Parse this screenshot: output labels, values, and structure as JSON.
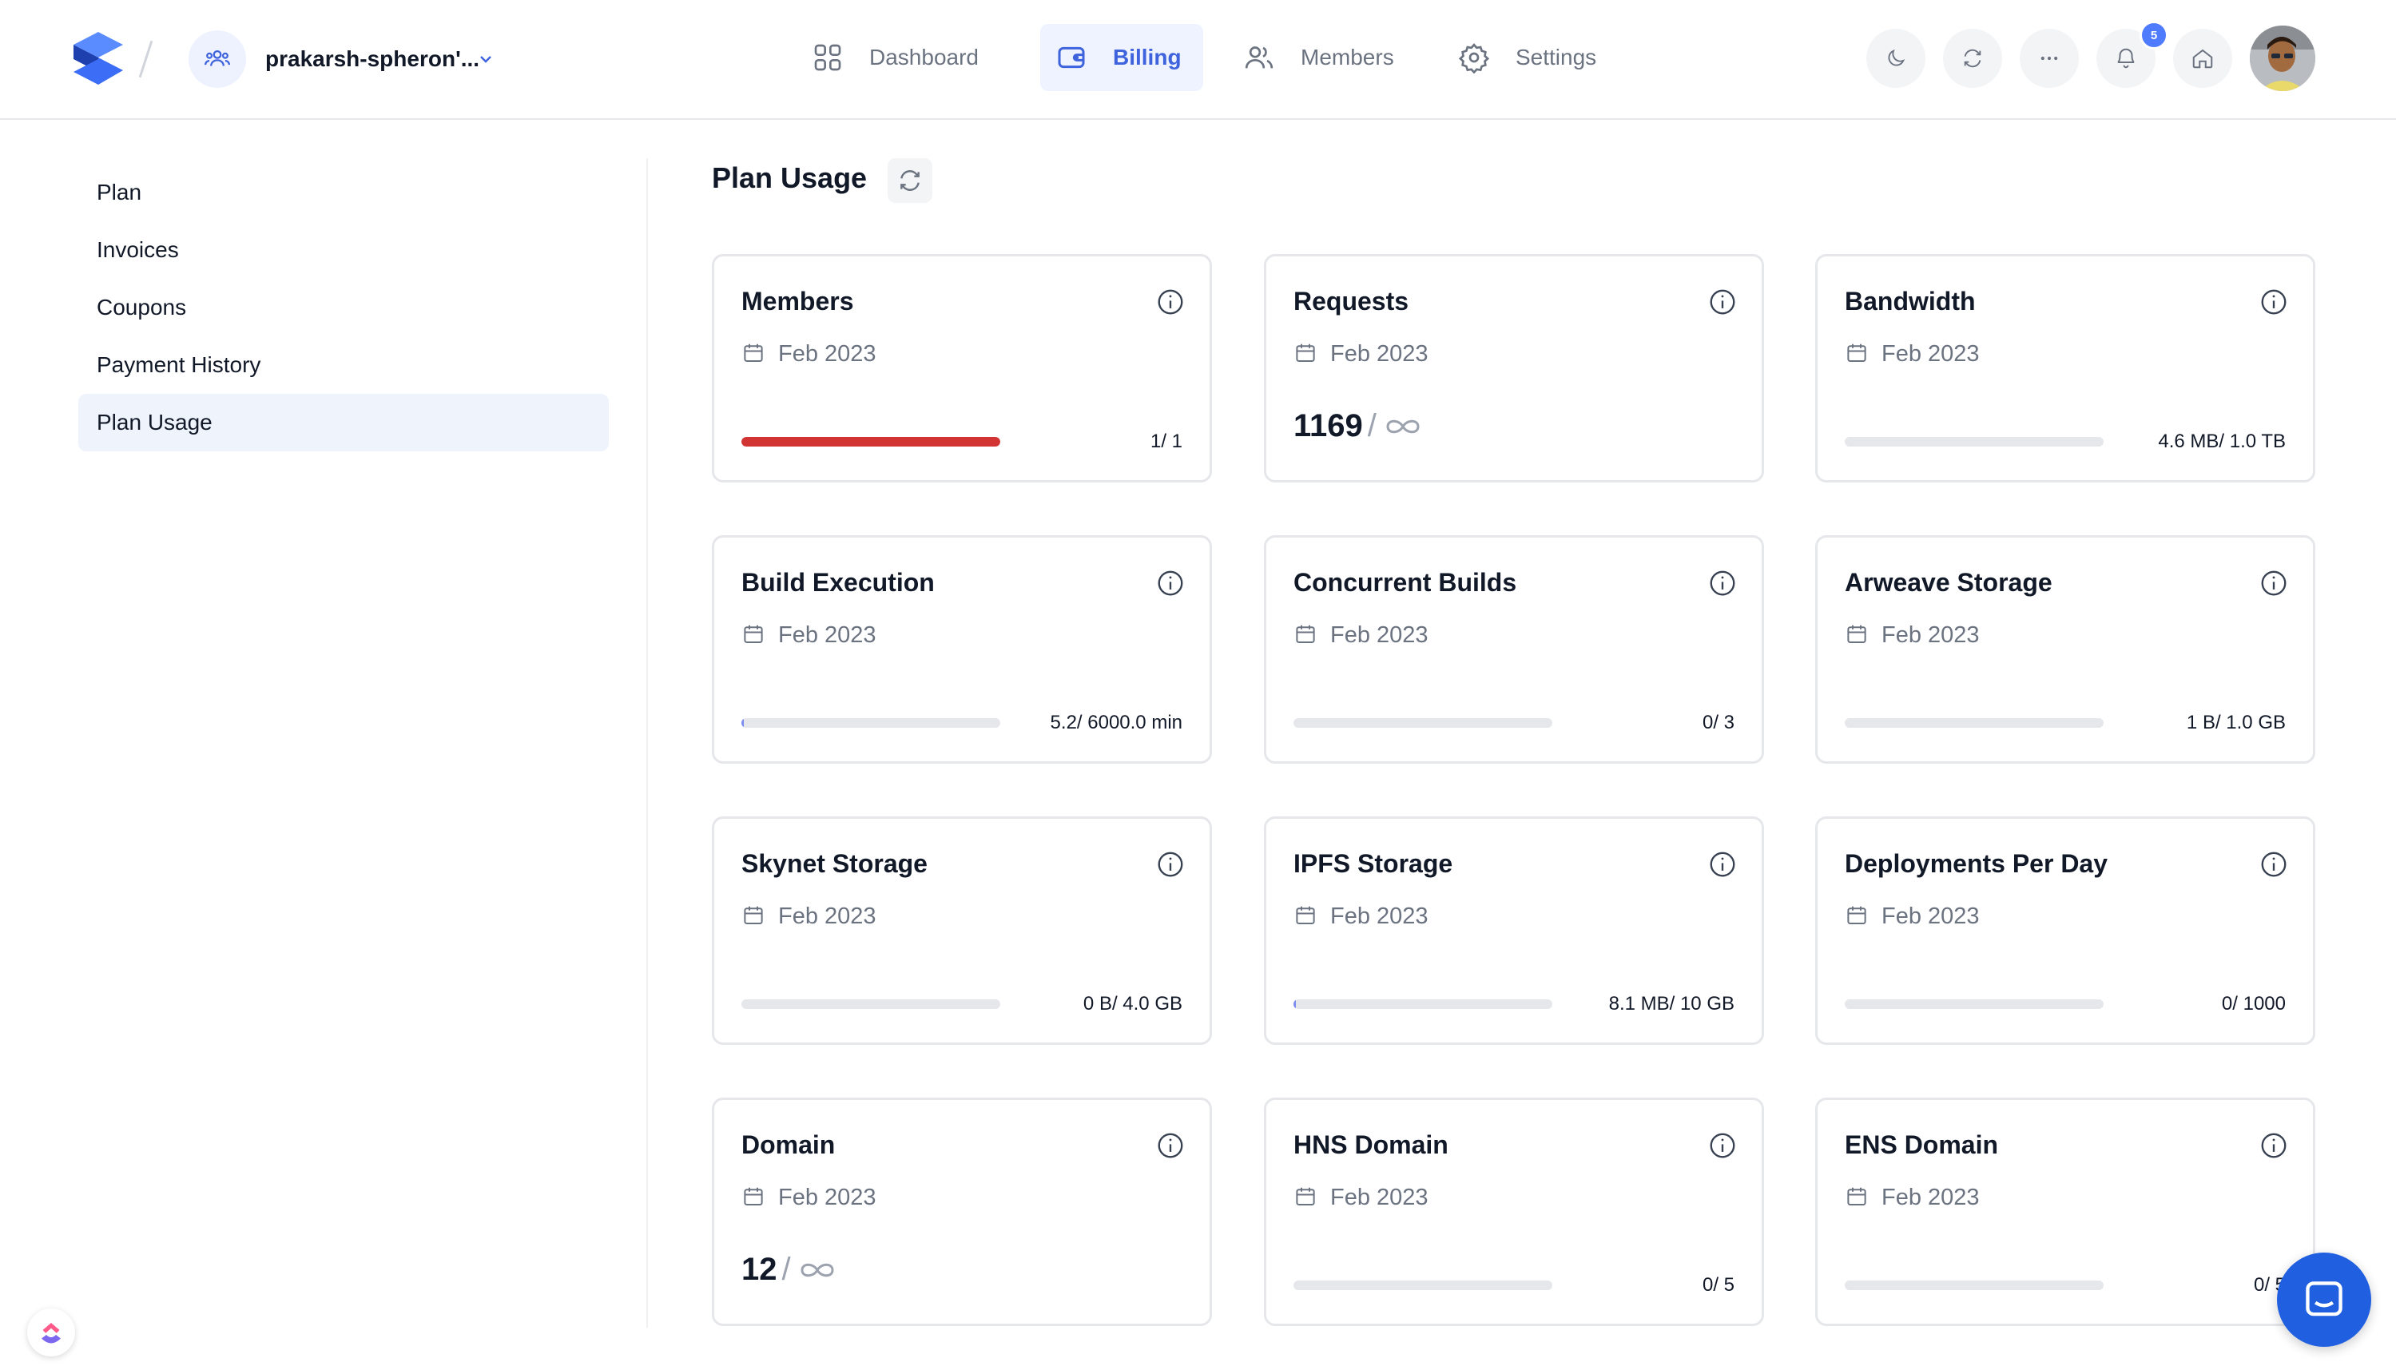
{
  "topbar": {
    "org_name": "prakarsh-spheron'...",
    "nav": [
      {
        "label": "Dashboard",
        "icon": "grid-icon",
        "active": false
      },
      {
        "label": "Billing",
        "icon": "wallet-icon",
        "active": true
      },
      {
        "label": "Members",
        "icon": "users-icon",
        "active": false
      },
      {
        "label": "Settings",
        "icon": "gear-icon",
        "active": false
      }
    ],
    "notification_count": "5",
    "icons": [
      "moon-icon",
      "sync-icon",
      "more-icon",
      "bell-icon",
      "home-icon"
    ]
  },
  "sidebar": {
    "items": [
      {
        "label": "Plan",
        "active": false
      },
      {
        "label": "Invoices",
        "active": false
      },
      {
        "label": "Coupons",
        "active": false
      },
      {
        "label": "Payment History",
        "active": false
      },
      {
        "label": "Plan Usage",
        "active": true
      }
    ]
  },
  "main": {
    "title": "Plan Usage",
    "cards": [
      {
        "title": "Members",
        "date": "Feb 2023",
        "value": "1/ 1",
        "fraction": 1.0
      },
      {
        "title": "Requests",
        "date": "Feb 2023",
        "big_value": "1169",
        "unlimited": true
      },
      {
        "title": "Bandwidth",
        "date": "Feb 2023",
        "value": "4.6 MB/ 1.0 TB",
        "fraction": 0.0
      },
      {
        "title": "Build Execution",
        "date": "Feb 2023",
        "value": "5.2/ 6000.0 min",
        "fraction": 0.001
      },
      {
        "title": "Concurrent Builds",
        "date": "Feb 2023",
        "value": "0/ 3",
        "fraction": 0.0
      },
      {
        "title": "Arweave Storage",
        "date": "Feb 2023",
        "value": "1 B/ 1.0 GB",
        "fraction": 0.0
      },
      {
        "title": "Skynet Storage",
        "date": "Feb 2023",
        "value": "0 B/ 4.0 GB",
        "fraction": 0.0
      },
      {
        "title": "IPFS Storage",
        "date": "Feb 2023",
        "value": "8.1 MB/ 10 GB",
        "fraction": 0.001
      },
      {
        "title": "Deployments Per Day",
        "date": "Feb 2023",
        "value": "0/ 1000",
        "fraction": 0.0
      },
      {
        "title": "Domain",
        "date": "Feb 2023",
        "big_value": "12",
        "unlimited": true
      },
      {
        "title": "HNS Domain",
        "date": "Feb 2023",
        "value": "0/ 5",
        "fraction": 0.0
      },
      {
        "title": "ENS Domain",
        "date": "Feb 2023",
        "value": "0/ 5",
        "fraction": 0.0
      }
    ]
  },
  "colors": {
    "accent": "#3e63dd",
    "over_limit": "#d23434",
    "progress": "#7c8df0",
    "track": "#e5e7eb"
  }
}
